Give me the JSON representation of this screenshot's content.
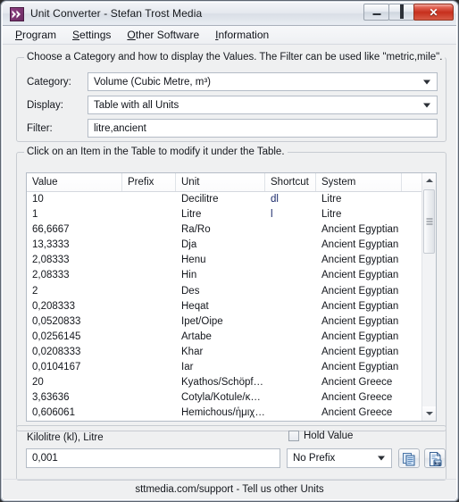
{
  "window": {
    "title": "Unit Converter - Stefan Trost Media",
    "app_icon": "double-chevron-icon",
    "buttons": {
      "minimize": "minimize-icon",
      "maximize": "maximize-icon",
      "close": "close-icon"
    }
  },
  "menubar": {
    "items": [
      {
        "label": "Program",
        "accel": "P"
      },
      {
        "label": "Settings",
        "accel": "S"
      },
      {
        "label": "Other Software",
        "accel": "O"
      },
      {
        "label": "Information",
        "accel": "I"
      }
    ]
  },
  "settings_group": {
    "legend": "Choose a Category and how to display the Values. The Filter can be used like \"metric,mile\".",
    "category_label": "Category:",
    "category_value": "Volume (Cubic Metre, m³)",
    "display_label": "Display:",
    "display_value": "Table with all Units",
    "filter_label": "Filter:",
    "filter_value": "litre,ancient",
    "filter_placeholder": ""
  },
  "table_group": {
    "legend": "Click on an Item in the Table to modify it under the Table.",
    "columns": [
      "Value",
      "Prefix",
      "Unit",
      "Shortcut",
      "System"
    ],
    "rows": [
      {
        "value": "10",
        "prefix": "",
        "unit": "Decilitre",
        "shortcut": "dl",
        "system": "Litre"
      },
      {
        "value": "1",
        "prefix": "",
        "unit": "Litre",
        "shortcut": "l",
        "system": "Litre"
      },
      {
        "value": "66,6667",
        "prefix": "",
        "unit": "Ra/Ro",
        "shortcut": "",
        "system": "Ancient Egyptian"
      },
      {
        "value": "13,3333",
        "prefix": "",
        "unit": "Dja",
        "shortcut": "",
        "system": "Ancient Egyptian"
      },
      {
        "value": "2,08333",
        "prefix": "",
        "unit": "Henu",
        "shortcut": "",
        "system": "Ancient Egyptian"
      },
      {
        "value": "2,08333",
        "prefix": "",
        "unit": "Hin",
        "shortcut": "",
        "system": "Ancient Egyptian"
      },
      {
        "value": "2",
        "prefix": "",
        "unit": "Des",
        "shortcut": "",
        "system": "Ancient Egyptian"
      },
      {
        "value": "0,208333",
        "prefix": "",
        "unit": "Heqat",
        "shortcut": "",
        "system": "Ancient Egyptian"
      },
      {
        "value": "0,0520833",
        "prefix": "",
        "unit": "Ipet/Oipe",
        "shortcut": "",
        "system": "Ancient Egyptian"
      },
      {
        "value": "0,0256145",
        "prefix": "",
        "unit": "Artabe",
        "shortcut": "",
        "system": "Ancient Egyptian"
      },
      {
        "value": "0,0208333",
        "prefix": "",
        "unit": "Khar",
        "shortcut": "",
        "system": "Ancient Egyptian"
      },
      {
        "value": "0,0104167",
        "prefix": "",
        "unit": "Iar",
        "shortcut": "",
        "system": "Ancient Egyptian"
      },
      {
        "value": "20",
        "prefix": "",
        "unit": "Kyathos/Schöpf…",
        "shortcut": "",
        "system": "Ancient Greece"
      },
      {
        "value": "3,63636",
        "prefix": "",
        "unit": "Cotyla/Kotule/κ…",
        "shortcut": "",
        "system": "Ancient Greece"
      },
      {
        "value": "0,606061",
        "prefix": "",
        "unit": "Hemichous/ἡμιχ…",
        "shortcut": "",
        "system": "Ancient Greece"
      }
    ]
  },
  "edit_panel": {
    "unit_label": "Kilolitre (kl), Litre",
    "value": "0,001",
    "value_placeholder": "",
    "hold_value_label": "Hold Value",
    "hold_value_checked": false,
    "prefix_value": "No Prefix",
    "copy_button_icon": "copy-icon",
    "unit_button_icon": "kg-document-icon"
  },
  "statusbar": {
    "text": "sttmedia.com/support - Tell us other Units"
  },
  "colors": {
    "accent": "#1b2a6b",
    "titlebar": "#e4e8ee",
    "client_bg": "#eff0f1",
    "close_red": "#c62f1d"
  }
}
